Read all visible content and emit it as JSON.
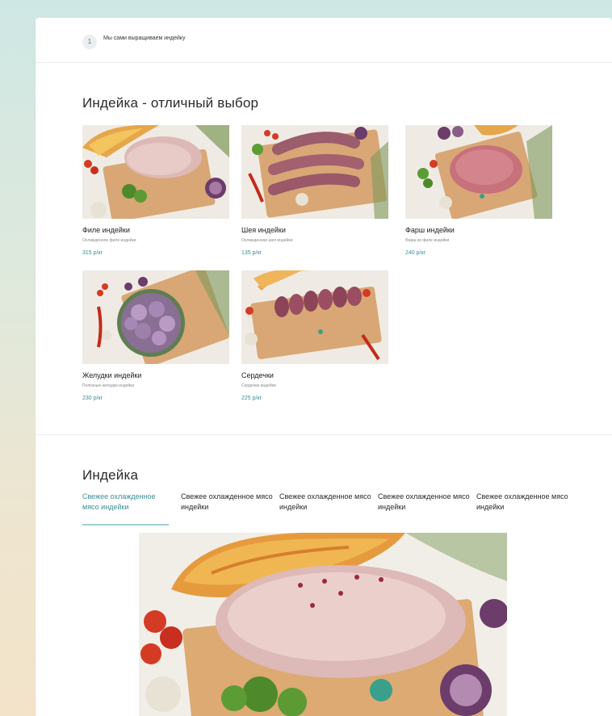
{
  "topbar": {
    "step_number": "1",
    "step_text": "Мы сами выращиваем индейку"
  },
  "section1": {
    "title": "Индейка - отличный выбор",
    "products": [
      {
        "name": "Филе индейки",
        "desc": "Охлажденное филе индейки",
        "price": "315 р/кг",
        "icon": "turkey-fillet-photo"
      },
      {
        "name": "Шея индейки",
        "desc": "Охлажденная шея индейки",
        "price": "135 р/кг",
        "icon": "turkey-neck-photo"
      },
      {
        "name": "Фарш индейки",
        "desc": "Фарш из филе индейки",
        "price": "240 р/кг",
        "icon": "minced-turkey-photo"
      },
      {
        "name": "Желудки индейки",
        "desc": "Полезные желудки индейки",
        "price": "230 р/кг",
        "icon": "turkey-gizzards-photo"
      },
      {
        "name": "Сердечки",
        "desc": "Сердечки индейки",
        "price": "225 р/кг",
        "icon": "turkey-hearts-photo"
      }
    ]
  },
  "section2": {
    "title": "Индейка",
    "tabs": [
      {
        "label": "Свежее охлажденное мясо индейки",
        "active": true
      },
      {
        "label": "Свежее охлажденное мясо индейки",
        "active": false
      },
      {
        "label": "Свежее охлажденное мясо индейки",
        "active": false
      },
      {
        "label": "Свежее охлажденное мясо индейки",
        "active": false
      },
      {
        "label": "Свежее охлажденное мясо индейки",
        "active": false
      }
    ]
  },
  "colors": {
    "accent": "#3a8e96",
    "tab_underline": "#9dcfd3"
  }
}
